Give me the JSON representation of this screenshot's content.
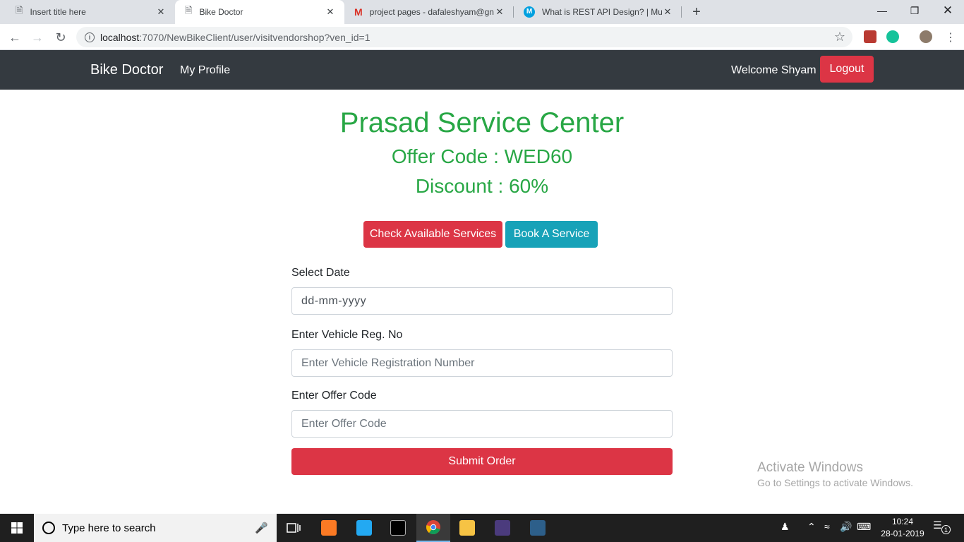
{
  "browser": {
    "tabs": [
      {
        "title": "Insert title here",
        "active": false
      },
      {
        "title": "Bike Doctor",
        "active": true
      },
      {
        "title": "project pages - dafaleshyam@gn",
        "active": false
      },
      {
        "title": "What is REST API Design? | Mule",
        "active": false
      }
    ],
    "url_host": "localhost",
    "url_path": ":7070/NewBikeClient/user/visitvendorshop?ven_id=1"
  },
  "navbar": {
    "brand": "Bike Doctor",
    "profile_link": "My Profile",
    "welcome": "Welcome Shyam",
    "logout": "Logout"
  },
  "shop": {
    "name": "Prasad Service Center",
    "offer_code_line": "Offer Code : WED60",
    "discount_line": "Discount : 60%"
  },
  "actions": {
    "check_services": "Check Available Services",
    "book_service": "Book A Service"
  },
  "form": {
    "date_label": "Select Date",
    "date_value": "dd-mm-yyyy",
    "reg_label": "Enter Vehicle Reg. No",
    "reg_placeholder": "Enter Vehicle Registration Number",
    "offer_label": "Enter Offer Code",
    "offer_placeholder": "Enter Offer Code",
    "submit": "Submit Order"
  },
  "watermark": {
    "line1": "Activate Windows",
    "line2": "Go to Settings to activate Windows."
  },
  "taskbar": {
    "search_placeholder": "Type here to search",
    "time": "10:24",
    "date": "28-01-2019",
    "notification_count": "1"
  },
  "colors": {
    "navbar_bg": "#343a40",
    "success_green": "#28a745",
    "danger_red": "#dc3545",
    "info_teal": "#17a2b8"
  }
}
